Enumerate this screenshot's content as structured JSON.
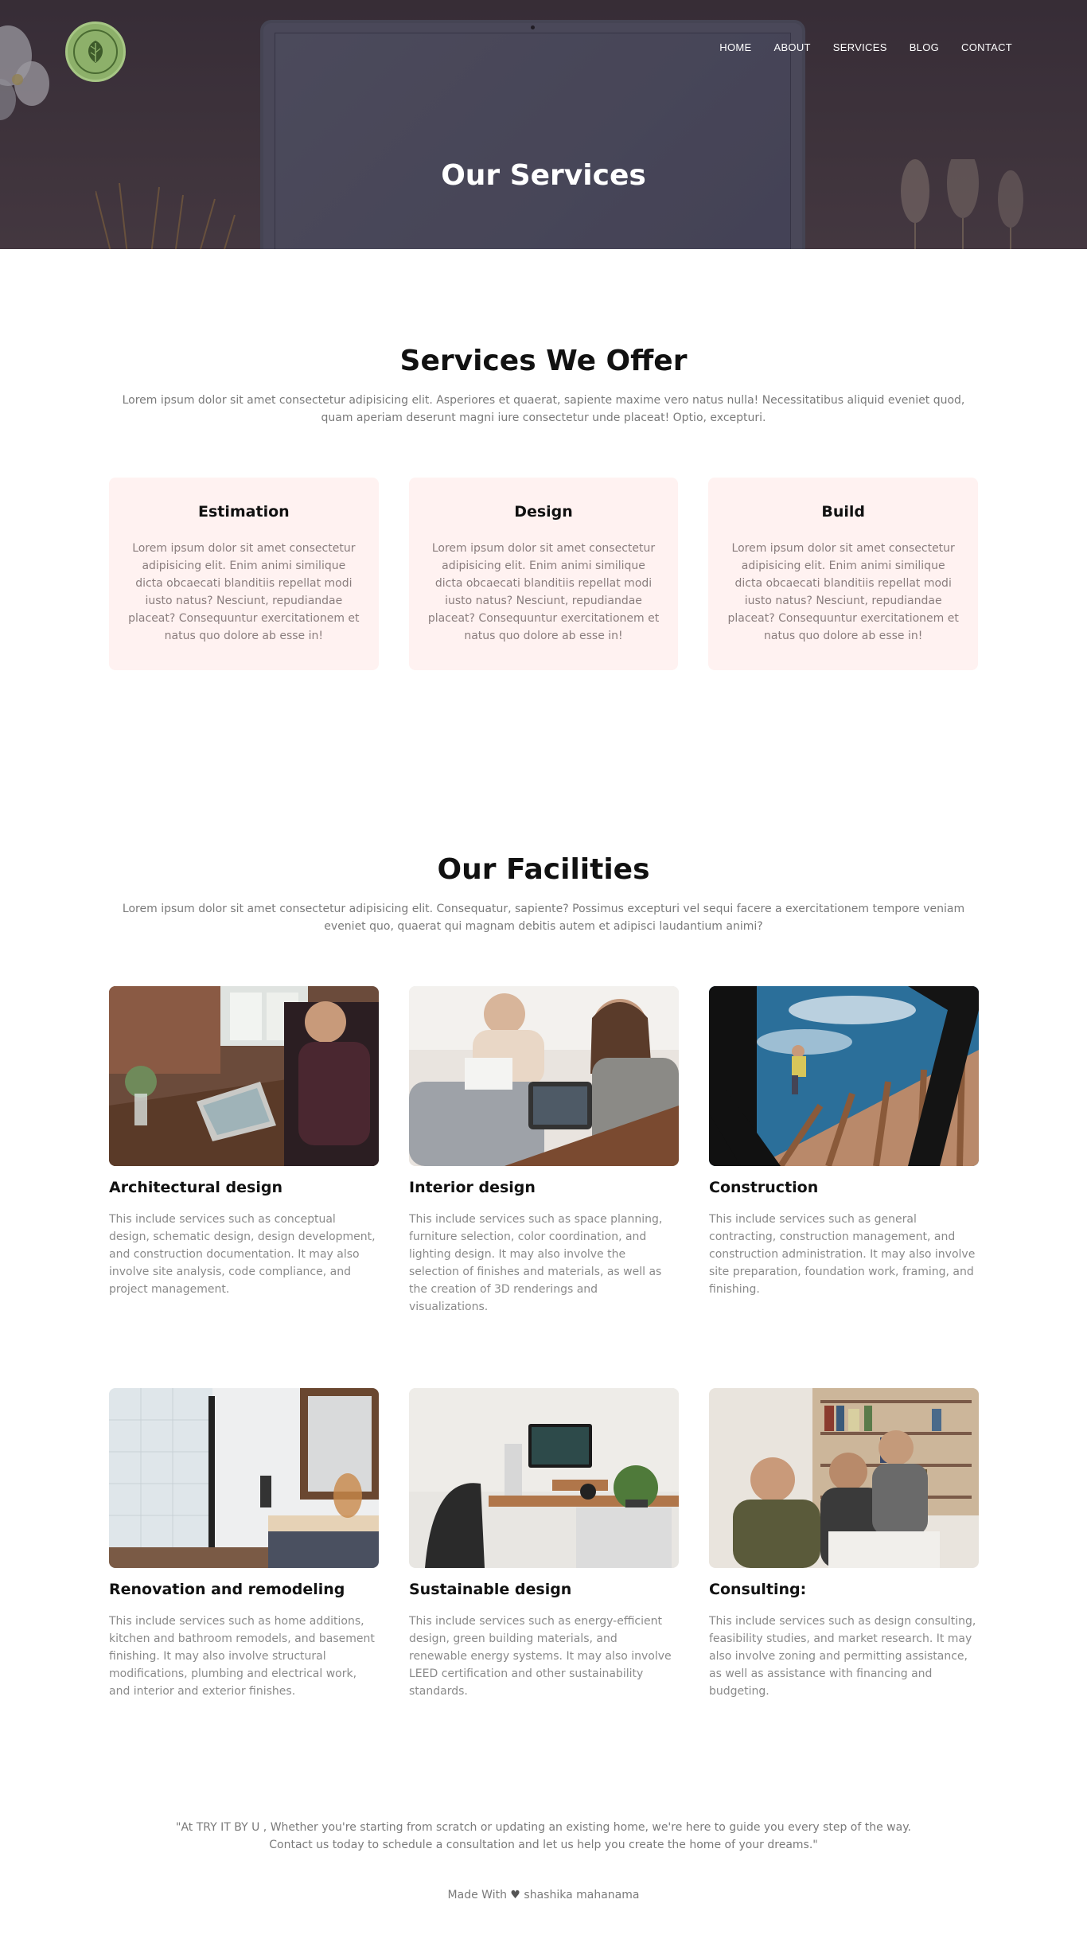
{
  "header": {
    "logo_alt": "leaf logo",
    "nav": [
      {
        "label": "HOME"
      },
      {
        "label": "ABOUT"
      },
      {
        "label": "SERVICES"
      },
      {
        "label": "BLOG"
      },
      {
        "label": "CONTACT"
      }
    ],
    "title": "Our Services"
  },
  "offer": {
    "title": "Services We Offer",
    "subtitle": "Lorem ipsum dolor sit amet consectetur adipisicing elit. Asperiores et quaerat, sapiente maxime vero natus nulla! Necessitatibus aliquid eveniet quod, quam aperiam deserunt magni iure consectetur unde placeat! Optio, excepturi.",
    "cards": [
      {
        "title": "Estimation",
        "text": "Lorem ipsum dolor sit amet consectetur adipisicing elit. Enim animi similique dicta obcaecati blanditiis repellat modi iusto natus? Nesciunt, repudiandae placeat? Consequuntur exercitationem et natus quo dolore ab esse in!"
      },
      {
        "title": "Design",
        "text": "Lorem ipsum dolor sit amet consectetur adipisicing elit. Enim animi similique dicta obcaecati blanditiis repellat modi iusto natus? Nesciunt, repudiandae placeat? Consequuntur exercitationem et natus quo dolore ab esse in!"
      },
      {
        "title": "Build",
        "text": "Lorem ipsum dolor sit amet consectetur adipisicing elit. Enim animi similique dicta obcaecati blanditiis repellat modi iusto natus? Nesciunt, repudiandae placeat? Consequuntur exercitationem et natus quo dolore ab esse in!"
      }
    ]
  },
  "facilities": {
    "title": "Our Facilities",
    "subtitle": "Lorem ipsum dolor sit amet consectetur adipisicing elit. Consequatur, sapiente? Possimus excepturi vel sequi facere a exercitationem tempore veniam eveniet quo, quaerat qui magnam debitis autem et adipisci laudantium animi?",
    "items": [
      {
        "title": "Architectural design",
        "text": "This include services such as conceptual design, schematic design, design development, and construction documentation. It may also involve site analysis, code compliance, and project management."
      },
      {
        "title": "Interior design",
        "text": "This include services such as space planning, furniture selection, color coordination, and lighting design. It may also involve the selection of finishes and materials, as well as the creation of 3D renderings and visualizations."
      },
      {
        "title": "Construction",
        "text": "This include services such as general contracting, construction management, and construction administration. It may also involve site preparation, foundation work, framing, and finishing."
      },
      {
        "title": "Renovation and remodeling",
        "text": "This include services such as home additions, kitchen and bathroom remodels, and basement finishing. It may also involve structural modifications, plumbing and electrical work, and interior and exterior finishes."
      },
      {
        "title": "Sustainable design",
        "text": "This include services such as energy-efficient design, green building materials, and renewable energy systems. It may also involve LEED certification and other sustainability standards."
      },
      {
        "title": "Consulting:",
        "text": "This include services such as design consulting, feasibility studies, and market research. It may also involve zoning and permitting assistance, as well as assistance with financing and budgeting."
      }
    ]
  },
  "quote": {
    "line1": "\"At TRY IT BY U , Whether you're starting from scratch or updating an existing home, we're here to guide you every step of the way.",
    "line2": "Contact us today to schedule a consultation and let us help you create the home of your dreams.\""
  },
  "footer": {
    "made_with": "Made With",
    "heart_icon": "heart-icon",
    "author": "shashika mahanama"
  }
}
